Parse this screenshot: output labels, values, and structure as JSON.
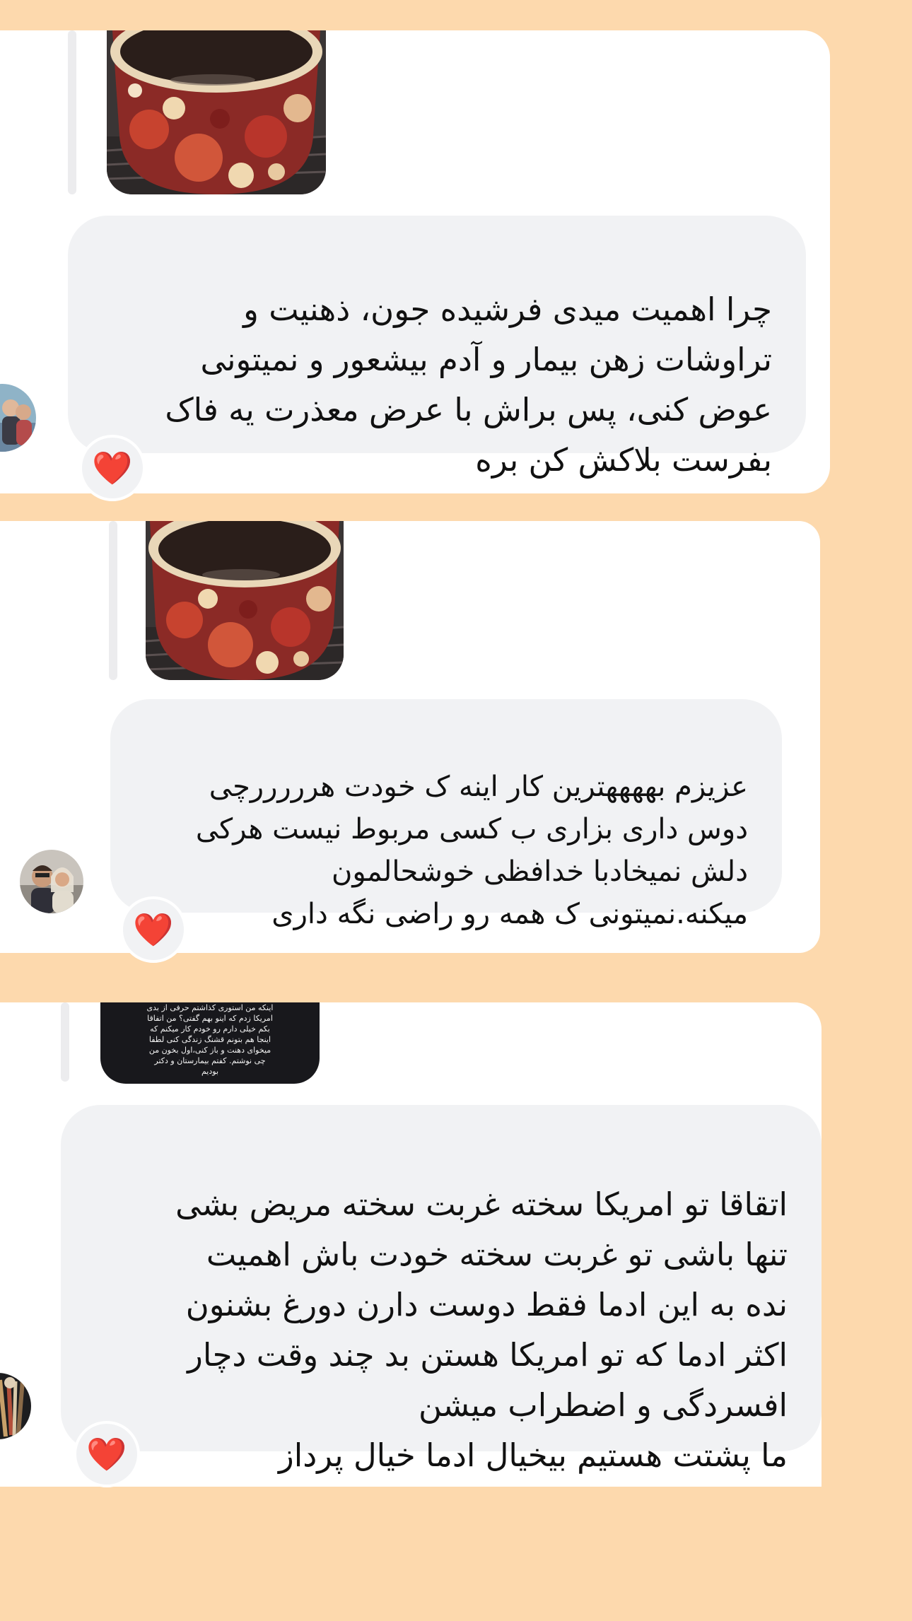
{
  "messages": [
    {
      "text": "چرا اهمیت میدی فرشیده جون، ذهنیت و\nتراوشات زهن بیمار و آدم بیشعور و نمیتونی\nعوض کنی، پس براش با عرض معذرت یه فاک\nبفرست بلاکش کن بره",
      "reaction": "❤️",
      "replied_to": "story-photo-teacup"
    },
    {
      "text": "عزیزم بههههترین کار اینه ک خودت هرررررچی\nدوس داری بزاری ب کسی مربوط نیست هرکی\nدلش نمیخادبا خدافظی خوشحالمون\nمیکنه.نمیتونی ک همه رو راضی نگه داری",
      "reaction": "❤️",
      "replied_to": "story-photo-teacup"
    },
    {
      "text": "اتقاقا تو امریکا سخته غربت سخته مریض بشی\nتنها باشی تو غربت سخته خودت باش  اهمیت\nنده به این ادما فقط دوست دارن دورغ بشنون\nاکثر ادما که تو امریکا هستن بد چند وقت دچار\nافسردگی و اضطراب میشن\nما پشتت هستیم بیخیال ادما خیال پرداز",
      "reaction": "❤️",
      "replied_to": "story-text-dark",
      "story_text": "اینکه من استوری کذاشتم حرفی از بدی\nامریکا زدم که اینو بهم گفتی؟ من اتفاقا\nبکم خیلی دارم رو خودم کار میکنم که\nاینجا هم بتونم قشنگ زندگی کنی لطفا\nمیخوای دهنت و باز کنی،اول بخون من\nچی نوشتم. کفتم بیمارستان و دکتر\nبودیم"
    }
  ],
  "colors": {
    "page_background": "#fdd9ad",
    "card_background": "#ffffff",
    "bubble_background": "#f1f2f4",
    "reaction_heart": "#e8202c"
  }
}
